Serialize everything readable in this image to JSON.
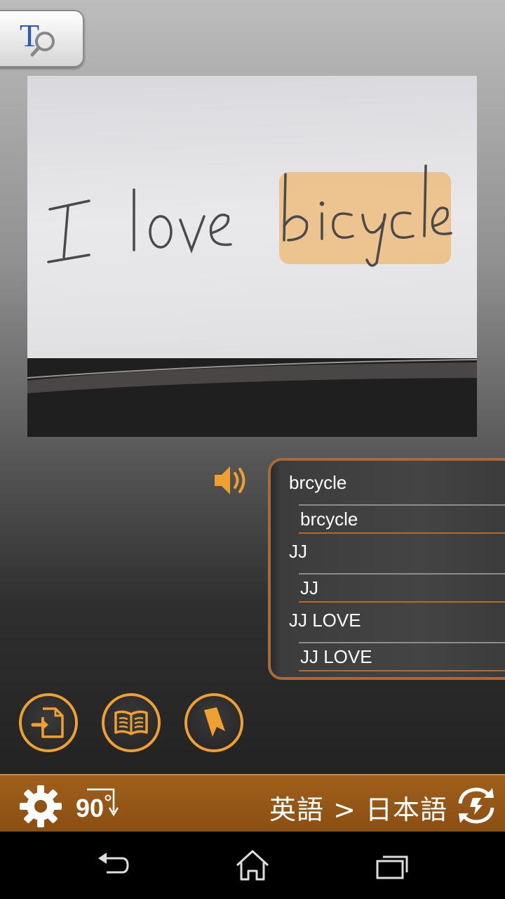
{
  "app_icon": {
    "icon": "text-search-icon",
    "letter": "T"
  },
  "photo": {
    "handwriting": [
      "I",
      "love",
      "bicycle"
    ],
    "highlighted_word": "bicycle",
    "highlight_color": "#f0b060"
  },
  "speaker": {
    "icon": "speaker-icon",
    "color": "#f0a030"
  },
  "results": [
    {
      "text": "brcycle",
      "translation": "brcycle"
    },
    {
      "text": "JJ",
      "translation": "JJ"
    },
    {
      "text": "JJ LOVE",
      "translation": "JJ LOVE"
    }
  ],
  "tools": [
    {
      "icon": "import-file-icon"
    },
    {
      "icon": "dictionary-book-icon"
    },
    {
      "icon": "bookmark-icon"
    }
  ],
  "bottom_bar": {
    "settings_icon": "gear-icon",
    "rotate_label": "90",
    "language_pair": "英語 > 日本語",
    "swap_icon": "swap-language-icon",
    "color": "#8e5216"
  },
  "nav": {
    "back": "back-icon",
    "home": "home-icon",
    "recents": "recents-icon"
  }
}
